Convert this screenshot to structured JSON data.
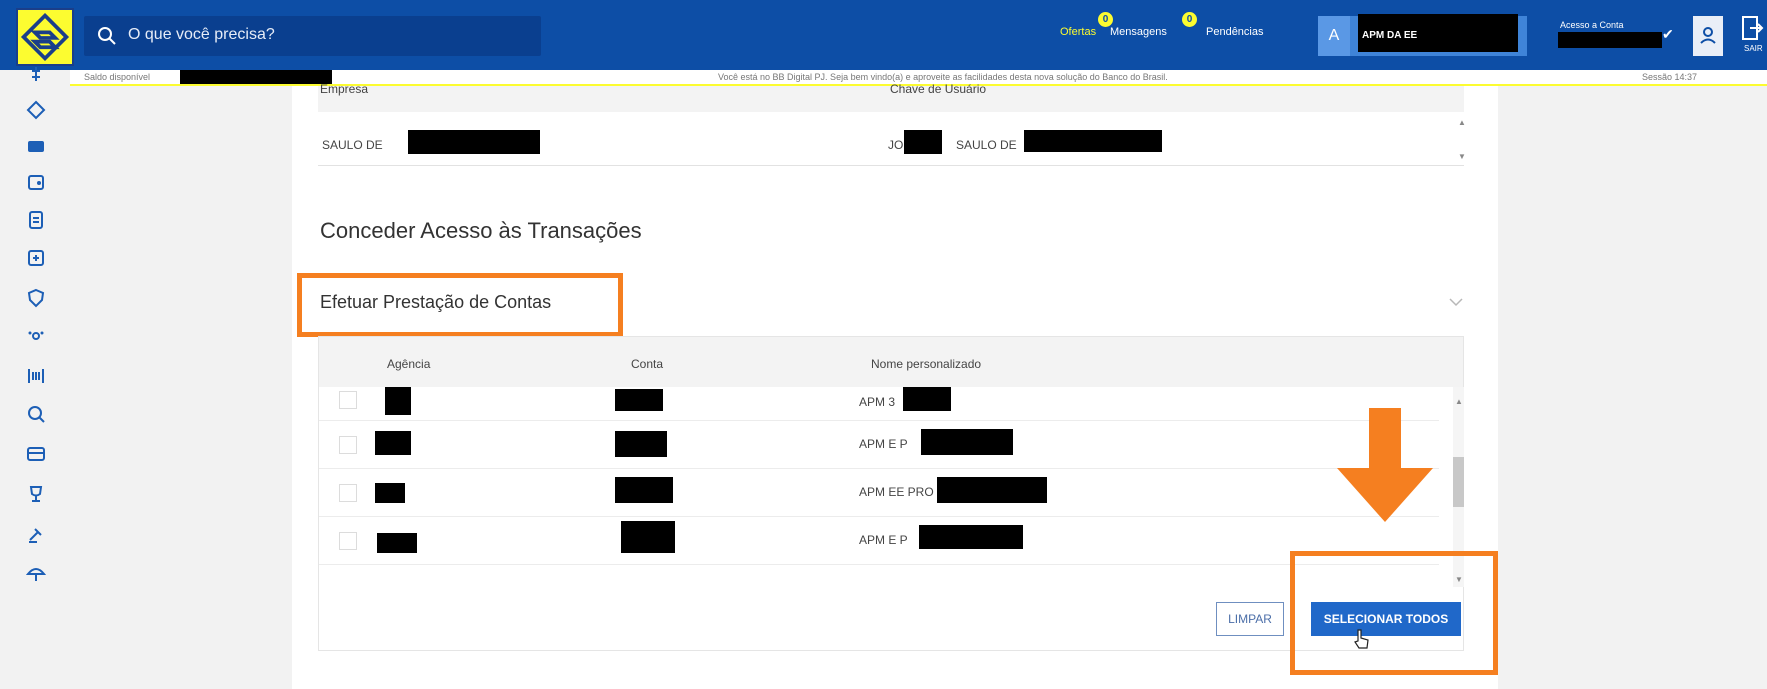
{
  "header": {
    "search_placeholder": "O que você precisa?",
    "nav": [
      {
        "label": "Ofertas",
        "badge": "0"
      },
      {
        "label": "Mensagens",
        "badge": "0"
      },
      {
        "label": "Pendências"
      }
    ],
    "account_letter": "A",
    "account_name": "APM DA EE",
    "assistance": "Acesso a Conta",
    "exit_label": "SAIR"
  },
  "strip": {
    "balance_label": "Saldo disponível",
    "welcome": "Você está no BB Digital PJ. Seja bem vindo(a) e aproveite as facilidades desta nova solução do Banco do Brasil.",
    "session": "Sessão 14:37"
  },
  "company_card": {
    "col_company": "Empresa",
    "col_user_key": "Chave de Usuário",
    "company_value": "SAULO DE",
    "user_key_prefix": "JO",
    "user_key_value": "SAULO DE"
  },
  "section_title": "Conceder Acesso às Transações",
  "accordion_title": "Efetuar Prestação de Contas",
  "table": {
    "headers": [
      "Agência",
      "Conta",
      "Nome personalizado"
    ],
    "rows": [
      {
        "name": "APM 3"
      },
      {
        "name": "APM E P"
      },
      {
        "name": "APM EE PRO"
      },
      {
        "name": "APM E P"
      }
    ]
  },
  "buttons": {
    "clear": "LIMPAR",
    "select_all": "SELECIONAR TODOS"
  },
  "colors": {
    "brand_blue": "#0d4ea6",
    "brand_yellow": "#fcfc30",
    "highlight_orange": "#f57f20",
    "primary_button": "#2068c9"
  }
}
